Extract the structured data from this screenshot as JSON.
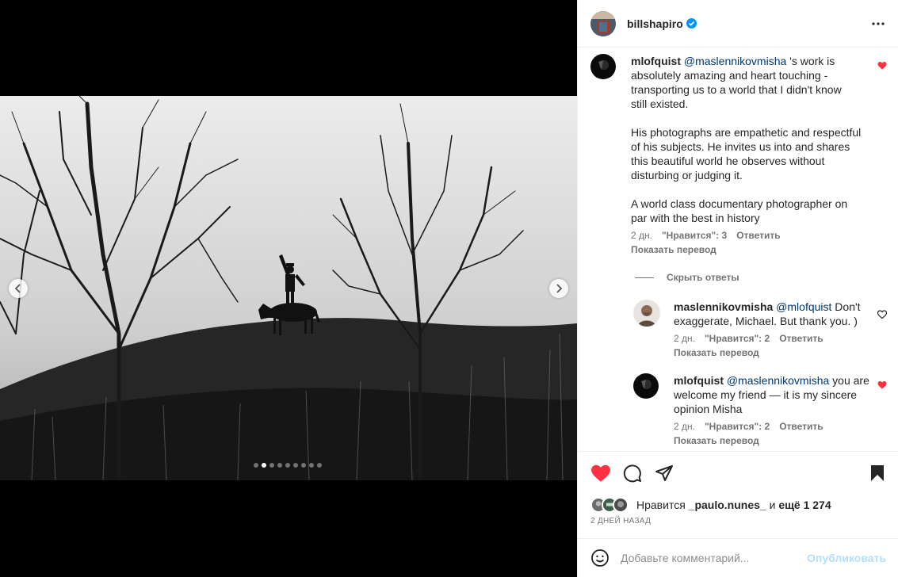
{
  "post": {
    "owner": "billshapiro",
    "carousel": {
      "slides": 9,
      "active": 1
    }
  },
  "comments": {
    "main": {
      "user": "mlofquist",
      "mention": "@maslennikovmisha",
      "text_lines": [
        "'s work is",
        "absolutely amazing and heart touching -",
        "transporting us to a world that I didn't know",
        "still existed.",
        "",
        "His photographs are empathetic and respectful",
        "of his subjects. He invites us into and shares",
        "this beautiful world he observes without",
        "disturbing or judging it.",
        "",
        "A world class documentary photographer on",
        "par with the best in history"
      ],
      "age": "2 дн.",
      "likes": "\"Нравится\": 3",
      "reply": "Ответить",
      "translate": "Показать перевод",
      "liked": true
    },
    "hide_replies": "Скрыть ответы",
    "replies": [
      {
        "user": "maslennikovmisha",
        "mention": "@mlofquist",
        "line1": "Don't",
        "line2": "exaggerate, Michael. But thank you. )",
        "age": "2 дн.",
        "likes": "\"Нравится\": 2",
        "reply": "Ответить",
        "translate": "Показать перевод",
        "liked": false
      },
      {
        "user": "mlofquist",
        "mention": "@maslennikovmisha",
        "line1": "you are",
        "line2": "welcome my friend — it is my sincere",
        "line3": "opinion Misha",
        "age": "2 дн.",
        "likes": "\"Нравится\": 2",
        "reply": "Ответить",
        "translate": "Показать перевод",
        "liked": true
      }
    ]
  },
  "likes": {
    "prefix": "Нравится",
    "user": "_paulo.nunes_",
    "and": "и",
    "more": "ещё 1 274"
  },
  "time_ago": "2 ДНЕЙ НАЗАД",
  "add_comment": {
    "placeholder": "Добавьте комментарий...",
    "publish": "Опубликовать"
  },
  "colors": {
    "heart_red": "#ff3040",
    "link_blue": "#00376b",
    "publish_disabled": "#b2dffc",
    "verified_blue": "#0095f6"
  }
}
